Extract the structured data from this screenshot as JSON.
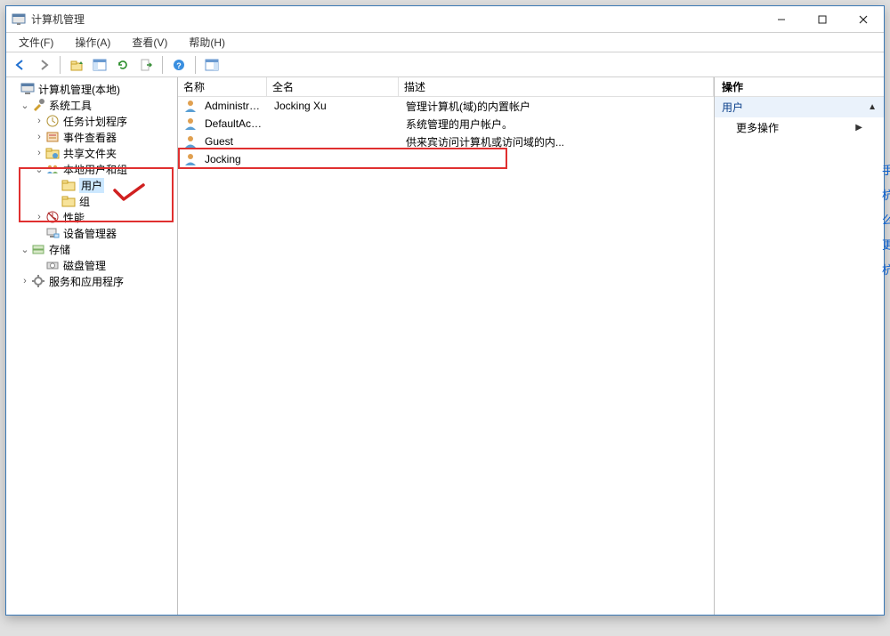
{
  "window": {
    "title": "计算机管理"
  },
  "menu": {
    "file": "文件(F)",
    "action": "操作(A)",
    "view": "查看(V)",
    "help": "帮助(H)"
  },
  "tree": {
    "root": "计算机管理(本地)",
    "sys_tools": "系统工具",
    "task_sched": "任务计划程序",
    "event_viewer": "事件查看器",
    "shared_folders": "共享文件夹",
    "local_users_groups": "本地用户和组",
    "users": "用户",
    "groups": "组",
    "performance": "性能",
    "device_mgr": "设备管理器",
    "storage": "存储",
    "disk_mgmt": "磁盘管理",
    "services_apps": "服务和应用程序"
  },
  "list": {
    "cols": {
      "name": "名称",
      "full": "全名",
      "desc": "描述"
    },
    "rows": [
      {
        "name": "Administrat...",
        "full": "Jocking Xu",
        "desc": "管理计算机(域)的内置帐户"
      },
      {
        "name": "DefaultAcc...",
        "full": "",
        "desc": "系统管理的用户帐户。"
      },
      {
        "name": "Guest",
        "full": "",
        "desc": "供来宾访问计算机或访问域的内..."
      },
      {
        "name": "Jocking",
        "full": "",
        "desc": ""
      }
    ]
  },
  "actions": {
    "header": "操作",
    "group": "用户",
    "more": "更多操作"
  }
}
